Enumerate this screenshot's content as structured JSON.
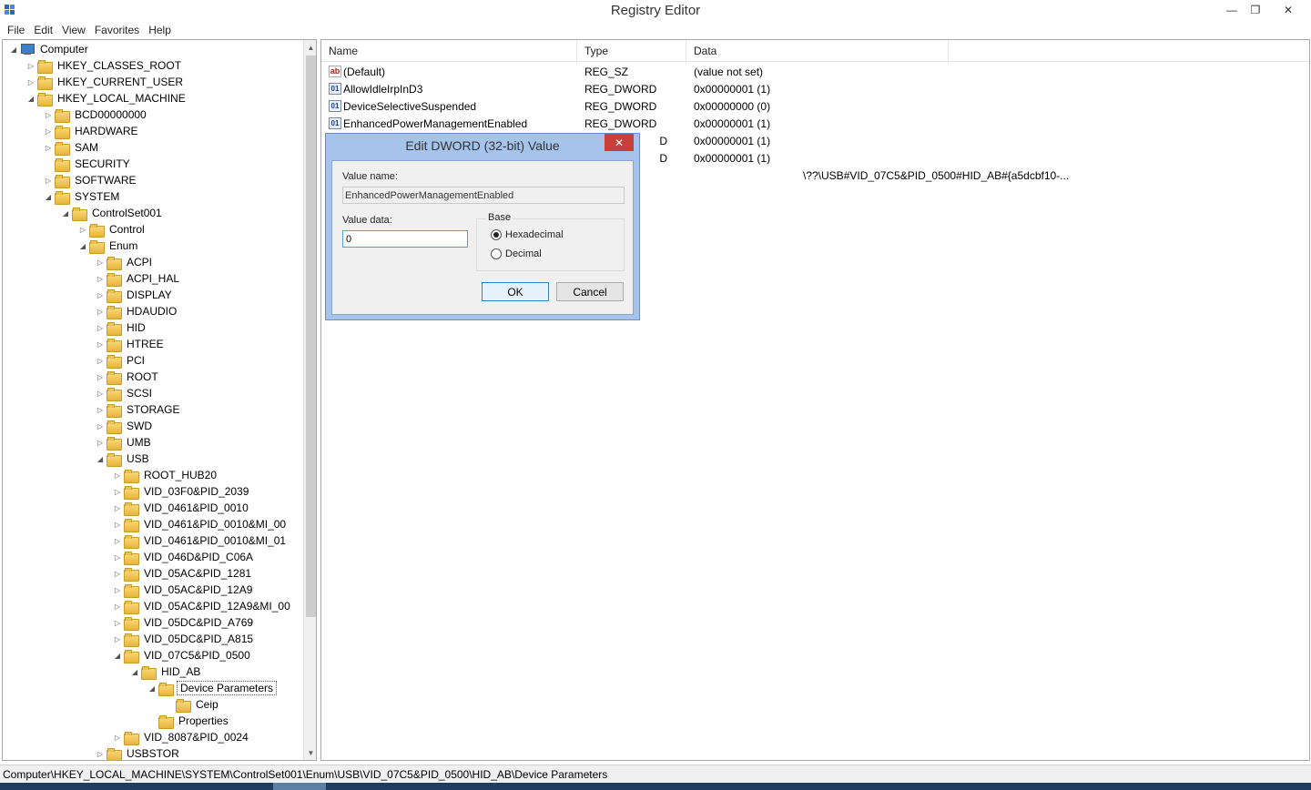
{
  "window": {
    "title": "Registry Editor"
  },
  "menu": [
    "File",
    "Edit",
    "View",
    "Favorites",
    "Help"
  ],
  "tree": [
    {
      "label": "Computer",
      "level": 0,
      "arrow": "◢",
      "type": "computer"
    },
    {
      "label": "HKEY_CLASSES_ROOT",
      "level": 1,
      "arrow": "▷"
    },
    {
      "label": "HKEY_CURRENT_USER",
      "level": 1,
      "arrow": "▷"
    },
    {
      "label": "HKEY_LOCAL_MACHINE",
      "level": 1,
      "arrow": "◢"
    },
    {
      "label": "BCD00000000",
      "level": 2,
      "arrow": "▷"
    },
    {
      "label": "HARDWARE",
      "level": 2,
      "arrow": "▷"
    },
    {
      "label": "SAM",
      "level": 2,
      "arrow": "▷"
    },
    {
      "label": "SECURITY",
      "level": 2,
      "arrow": ""
    },
    {
      "label": "SOFTWARE",
      "level": 2,
      "arrow": "▷"
    },
    {
      "label": "SYSTEM",
      "level": 2,
      "arrow": "◢"
    },
    {
      "label": "ControlSet001",
      "level": 3,
      "arrow": "◢"
    },
    {
      "label": "Control",
      "level": 4,
      "arrow": "▷"
    },
    {
      "label": "Enum",
      "level": 4,
      "arrow": "◢"
    },
    {
      "label": "ACPI",
      "level": 5,
      "arrow": "▷"
    },
    {
      "label": "ACPI_HAL",
      "level": 5,
      "arrow": "▷"
    },
    {
      "label": "DISPLAY",
      "level": 5,
      "arrow": "▷"
    },
    {
      "label": "HDAUDIO",
      "level": 5,
      "arrow": "▷"
    },
    {
      "label": "HID",
      "level": 5,
      "arrow": "▷"
    },
    {
      "label": "HTREE",
      "level": 5,
      "arrow": "▷"
    },
    {
      "label": "PCI",
      "level": 5,
      "arrow": "▷"
    },
    {
      "label": "ROOT",
      "level": 5,
      "arrow": "▷"
    },
    {
      "label": "SCSI",
      "level": 5,
      "arrow": "▷"
    },
    {
      "label": "STORAGE",
      "level": 5,
      "arrow": "▷"
    },
    {
      "label": "SWD",
      "level": 5,
      "arrow": "▷"
    },
    {
      "label": "UMB",
      "level": 5,
      "arrow": "▷"
    },
    {
      "label": "USB",
      "level": 5,
      "arrow": "◢"
    },
    {
      "label": "ROOT_HUB20",
      "level": 6,
      "arrow": "▷"
    },
    {
      "label": "VID_03F0&PID_2039",
      "level": 6,
      "arrow": "▷"
    },
    {
      "label": "VID_0461&PID_0010",
      "level": 6,
      "arrow": "▷"
    },
    {
      "label": "VID_0461&PID_0010&MI_00",
      "level": 6,
      "arrow": "▷"
    },
    {
      "label": "VID_0461&PID_0010&MI_01",
      "level": 6,
      "arrow": "▷"
    },
    {
      "label": "VID_046D&PID_C06A",
      "level": 6,
      "arrow": "▷"
    },
    {
      "label": "VID_05AC&PID_1281",
      "level": 6,
      "arrow": "▷"
    },
    {
      "label": "VID_05AC&PID_12A9",
      "level": 6,
      "arrow": "▷"
    },
    {
      "label": "VID_05AC&PID_12A9&MI_00",
      "level": 6,
      "arrow": "▷"
    },
    {
      "label": "VID_05DC&PID_A769",
      "level": 6,
      "arrow": "▷"
    },
    {
      "label": "VID_05DC&PID_A815",
      "level": 6,
      "arrow": "▷"
    },
    {
      "label": "VID_07C5&PID_0500",
      "level": 6,
      "arrow": "◢"
    },
    {
      "label": "HID_AB",
      "level": 7,
      "arrow": "◢"
    },
    {
      "label": "Device Parameters",
      "level": 8,
      "arrow": "◢",
      "selected": true
    },
    {
      "label": "Ceip",
      "level": 9,
      "arrow": ""
    },
    {
      "label": "Properties",
      "level": 8,
      "arrow": ""
    },
    {
      "label": "VID_8087&PID_0024",
      "level": 6,
      "arrow": "▷"
    },
    {
      "label": "USBSTOR",
      "level": 5,
      "arrow": "▷"
    }
  ],
  "list": {
    "columns": [
      "Name",
      "Type",
      "Data"
    ],
    "rows": [
      {
        "icon": "ab",
        "name": "(Default)",
        "type": "REG_SZ",
        "data": "(value not set)"
      },
      {
        "icon": "bin",
        "name": "AllowIdleIrpInD3",
        "type": "REG_DWORD",
        "data": "0x00000001 (1)"
      },
      {
        "icon": "bin",
        "name": "DeviceSelectiveSuspended",
        "type": "REG_DWORD",
        "data": "0x00000000 (0)"
      },
      {
        "icon": "bin",
        "name": "EnhancedPowerManagementEnabled",
        "type": "REG_DWORD",
        "data": "0x00000001 (1)"
      },
      {
        "icon": "",
        "name": "",
        "type": "D",
        "data": "0x00000001 (1)"
      },
      {
        "icon": "",
        "name": "",
        "type": "D",
        "data": "0x00000001 (1)"
      },
      {
        "icon": "",
        "name": "",
        "type": "",
        "data": "\\??\\USB#VID_07C5&PID_0500#HID_AB#{a5dcbf10-..."
      }
    ]
  },
  "dialog": {
    "title": "Edit DWORD (32-bit) Value",
    "value_name_label": "Value name:",
    "value_name": "EnhancedPowerManagementEnabled",
    "value_data_label": "Value data:",
    "value_data": "0",
    "base_label": "Base",
    "hex_label": "Hexadecimal",
    "dec_label": "Decimal",
    "ok_label": "OK",
    "cancel_label": "Cancel"
  },
  "status": {
    "path": "Computer\\HKEY_LOCAL_MACHINE\\SYSTEM\\ControlSet001\\Enum\\USB\\VID_07C5&PID_0500\\HID_AB\\Device Parameters"
  }
}
